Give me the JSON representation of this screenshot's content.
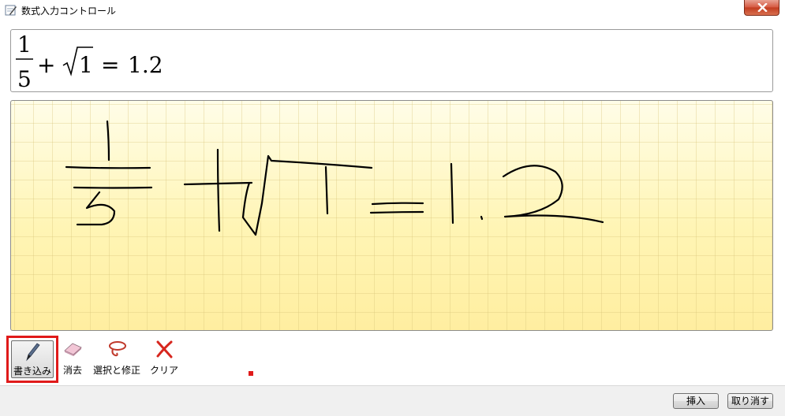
{
  "window": {
    "title": "数式入力コントロール",
    "icon": "math-input-icon"
  },
  "preview": {
    "numerator": "1",
    "denominator": "5",
    "plus": "+",
    "radicand": "1",
    "equals": "=",
    "result": "1.2"
  },
  "ink": {
    "strokes_depict": "1/5 + √1 = 1.2"
  },
  "toolbar": {
    "write_label": "書き込み",
    "erase_label": "消去",
    "select_label": "選択と修正",
    "clear_label": "クリア"
  },
  "footer": {
    "insert_label": "挿入",
    "cancel_label": "取り消す"
  },
  "colors": {
    "highlight": "#e01a1a",
    "ink": "#000000",
    "ink_background": "#fff5b5"
  }
}
